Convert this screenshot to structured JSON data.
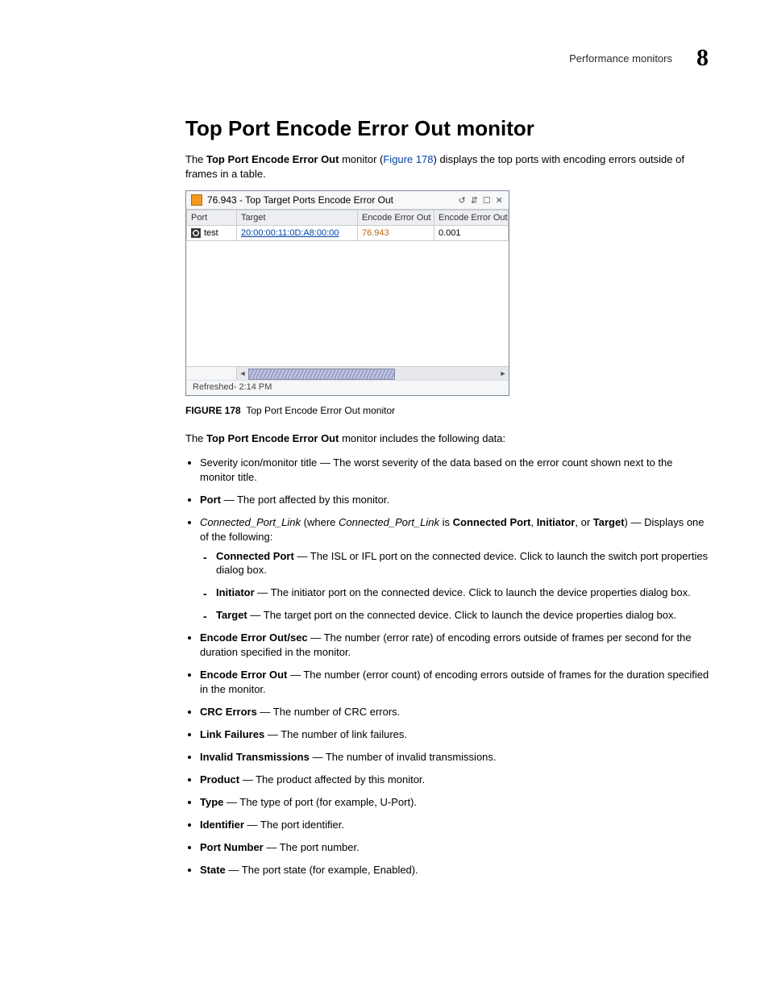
{
  "running_head": {
    "label": "Performance monitors",
    "chapter": "8"
  },
  "section_title": "Top Port Encode Error Out monitor",
  "intro": {
    "pre": "The ",
    "bold": "Top Port Encode Error Out",
    "mid": " monitor (",
    "link": "Figure 178",
    "post": ") displays the top ports with encoding errors outside of frames in a table."
  },
  "figure": {
    "title": "76.943 - Top Target Ports Encode Error Out",
    "icons": {
      "refresh": "↺",
      "collapse": "⇵",
      "max": "☐",
      "close": "✕"
    },
    "columns": {
      "port": "Port",
      "target": "Target",
      "err": "Encode Error Out",
      "rate": "Encode Error Out/sec"
    },
    "row": {
      "port": "test",
      "target": "20:00:00:11:0D:A8:00:00",
      "err": "76.943",
      "rate": "0.001"
    },
    "status": "Refreshed- 2:14 PM",
    "caption_label": "FIGURE 178",
    "caption_text": "Top Port Encode Error Out monitor"
  },
  "lead2": {
    "pre": "The ",
    "bold": "Top Port Encode Error Out",
    "post": " monitor includes the following data:"
  },
  "bullets": {
    "severity": "Severity icon/monitor title — The worst severity of the data based on the error count shown next to the monitor title.",
    "port_label": "Port",
    "port_text": " — The port affected by this monitor.",
    "cpl_varname": "Connected_Port_Link",
    "cpl_mid1": " (where ",
    "cpl_mid2": " is ",
    "cpl_b1": "Connected Port",
    "cpl_b2": "Initiator",
    "cpl_b3": "Target",
    "cpl_tail": ") — Displays one of the following:",
    "sub_cp_label": "Connected Port",
    "sub_cp_text": " — The ISL or IFL port on the connected device. Click to launch the switch port properties dialog box.",
    "sub_init_label": "Initiator",
    "sub_init_text": " — The initiator port on the connected device. Click to launch the device properties dialog box.",
    "sub_tgt_label": "Target",
    "sub_tgt_text": " — The target port on the connected device. Click to launch the device properties dialog box.",
    "rate_label": "Encode Error Out/sec",
    "rate_text": " — The number (error rate) of encoding errors outside of frames per second for the duration specified in the monitor.",
    "err_label": "Encode Error Out",
    "err_text": " — The number (error count) of encoding errors outside of frames for the duration specified in the monitor.",
    "crc_label": "CRC Errors",
    "crc_text": " — The number of CRC errors.",
    "lf_label": "Link Failures",
    "lf_text": " — The number of link failures.",
    "it_label": "Invalid Transmissions",
    "it_text": " — The number of invalid transmissions.",
    "prod_label": "Product",
    "prod_text": " — The product affected by this monitor.",
    "type_label": "Type",
    "type_text": " — The type of port (for example, U-Port).",
    "id_label": "Identifier",
    "id_text": " — The port identifier.",
    "pn_label": "Port Number",
    "pn_text": " — The port number.",
    "state_label": "State",
    "state_text": " — The port state (for example, Enabled)."
  }
}
